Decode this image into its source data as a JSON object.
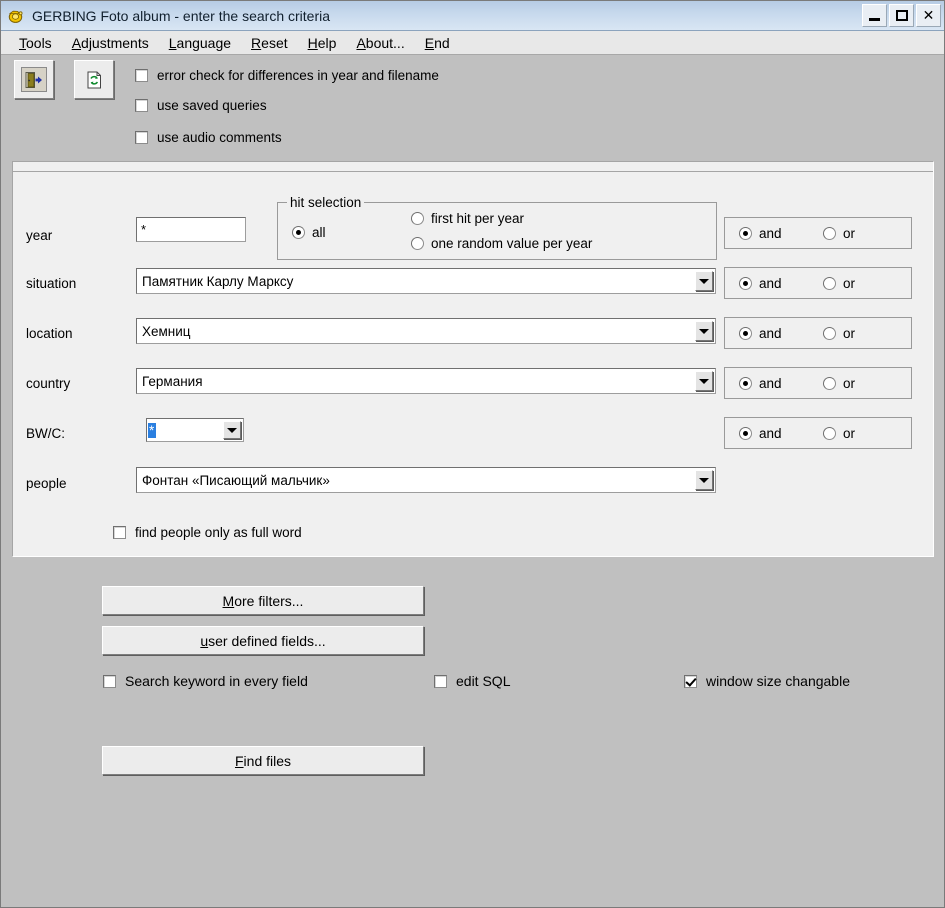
{
  "window": {
    "title": "GERBING Foto album - enter the search criteria",
    "app_icon": "camera-icon",
    "minimize_label": "_",
    "maximize_label": "□",
    "close_label": "✕"
  },
  "menu": {
    "items": [
      {
        "label": "Tools",
        "mnemonic": "T"
      },
      {
        "label": "Adjustments",
        "mnemonic": "A"
      },
      {
        "label": "Language",
        "mnemonic": "L"
      },
      {
        "label": "Reset",
        "mnemonic": "R"
      },
      {
        "label": "Help",
        "mnemonic": "H"
      },
      {
        "label": "About...",
        "mnemonic": "A"
      },
      {
        "label": "End",
        "mnemonic": "E"
      }
    ]
  },
  "toolbar": {
    "buttons": [
      {
        "icon": "exit-door-icon",
        "pressed": true
      },
      {
        "icon": "refresh-document-icon",
        "pressed": false
      }
    ],
    "checkboxes": [
      {
        "label": "error check for differences in year and filename",
        "checked": false
      },
      {
        "label": "use saved queries",
        "checked": false
      },
      {
        "label": "use audio comments",
        "checked": false
      }
    ]
  },
  "criteria": {
    "year": {
      "label": "year",
      "value": "*"
    },
    "hit_selection": {
      "title": "hit selection",
      "options": [
        {
          "label": "all",
          "selected": true
        },
        {
          "label": "first hit per year",
          "selected": false
        },
        {
          "label": "one random value per year",
          "selected": false
        }
      ]
    },
    "fields": [
      {
        "label": "situation",
        "value": "Памятник Карлу Марксу",
        "selected_text": false
      },
      {
        "label": "location",
        "value": "Хемниц",
        "selected_text": false
      },
      {
        "label": "country",
        "value": "Германия",
        "selected_text": false
      },
      {
        "label": "BW/C:",
        "value": "*",
        "selected_text": true
      },
      {
        "label": "people",
        "value": "Фонтан «Писающий мальчик»",
        "selected_text": false
      }
    ],
    "operators": [
      {
        "and_label": "and",
        "or_label": "or",
        "value": "and"
      },
      {
        "and_label": "and",
        "or_label": "or",
        "value": "and"
      },
      {
        "and_label": "and",
        "or_label": "or",
        "value": "and"
      },
      {
        "and_label": "and",
        "or_label": "or",
        "value": "and"
      },
      {
        "and_label": "and",
        "or_label": "or",
        "value": "and"
      }
    ],
    "full_word_checkbox": {
      "label": "find people only as full word",
      "checked": false
    }
  },
  "actions": {
    "more_filters": {
      "label": "More filters...",
      "mnemonic": "M"
    },
    "user_defined_fields": {
      "label": "user defined fields...",
      "mnemonic": "u"
    },
    "find_files": {
      "label": "Find files",
      "mnemonic": "F"
    },
    "checkboxes": [
      {
        "label": "Search keyword in every field",
        "checked": false
      },
      {
        "label": "edit SQL",
        "checked": false
      },
      {
        "label": "window size changable",
        "checked": true
      }
    ]
  },
  "colors": {
    "window_bg": "#c0c0c0",
    "panel_bg": "#f0f0f0",
    "titlebar": "#c6d8ec",
    "selection": "#2a7fe0"
  }
}
